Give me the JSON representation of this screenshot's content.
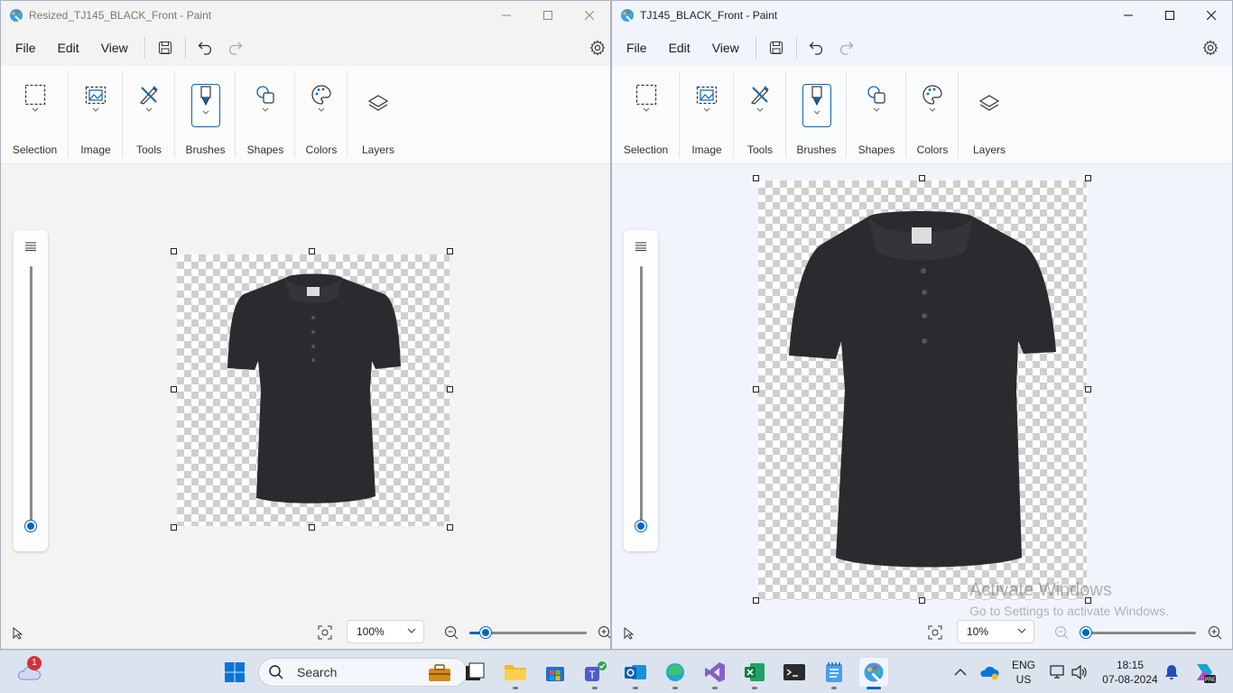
{
  "left_window": {
    "title": "Resized_TJ145_BLACK_Front - Paint",
    "zoom": "100%",
    "zoom_slider_fraction": 0.14
  },
  "right_window": {
    "title": "TJ145_BLACK_Front - Paint",
    "zoom": "10%",
    "zoom_slider_fraction": 0.0
  },
  "menu": {
    "file": "File",
    "edit": "Edit",
    "view": "View"
  },
  "ribbon": {
    "selection": "Selection",
    "image": "Image",
    "tools": "Tools",
    "brushes": "Brushes",
    "shapes": "Shapes",
    "colors": "Colors",
    "layers": "Layers"
  },
  "watermark": {
    "line1": "Activate Windows",
    "line2": "Go to Settings to activate Windows."
  },
  "taskbar": {
    "search_placeholder": "Search",
    "weather_badge": "1",
    "language_line1": "ENG",
    "language_line2": "US",
    "time": "18:15",
    "date": "07-08-2024"
  },
  "colors": {
    "accent": "#0067c0",
    "shirt": "#2a2b2f"
  }
}
